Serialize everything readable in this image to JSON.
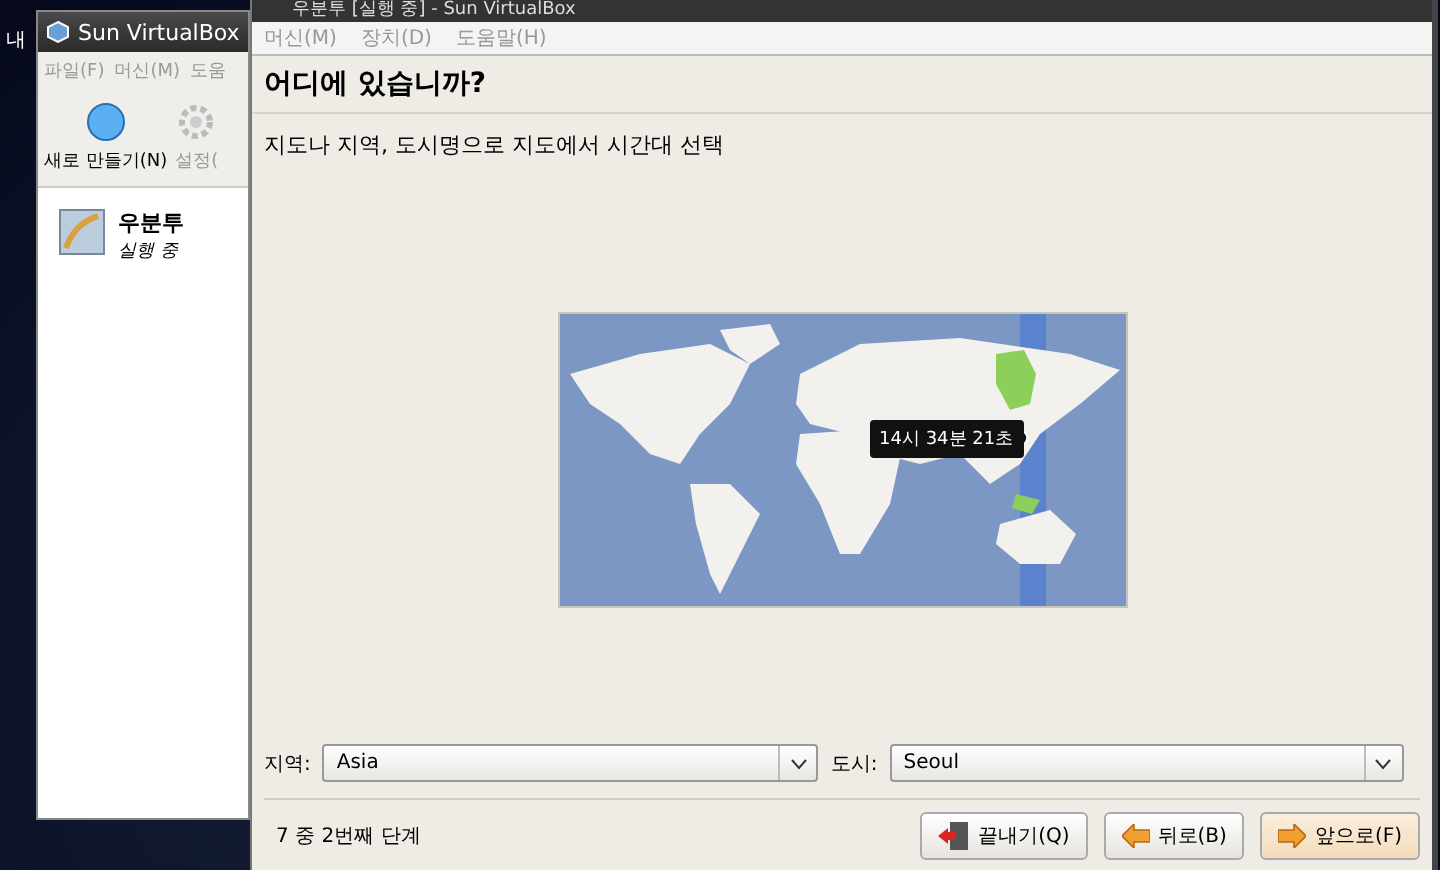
{
  "desktop": {
    "icon_labels": [
      "내"
    ]
  },
  "back_window": {
    "title": "Sun VirtualBox",
    "menu": [
      "파일(F)",
      "머신(M)",
      "도움"
    ],
    "toolbar": [
      {
        "label": "새로 만들기(N)",
        "kind": "new"
      },
      {
        "label": "설정(",
        "kind": "settings"
      }
    ],
    "vm_list": [
      {
        "name": "우분투",
        "status": "실행 중"
      }
    ]
  },
  "front_window": {
    "title": "우분투 [실행 중] - Sun VirtualBox",
    "menu": [
      "머신(M)",
      "장치(D)",
      "도움말(H)"
    ]
  },
  "wizard": {
    "heading": "어디에 있습니까?",
    "description": "지도나 지역, 도시명으로 지도에서 시간대 선택",
    "map": {
      "time_tooltip": "14시 34분 21초"
    },
    "region": {
      "label": "지역:",
      "value": "Asia"
    },
    "city": {
      "label": "도시:",
      "value": "Seoul"
    },
    "step": "7 중 2번째 단계",
    "buttons": [
      {
        "label": "끝내기(Q)",
        "kind": "quit"
      },
      {
        "label": "뒤로(B)",
        "kind": "back"
      },
      {
        "label": "앞으로(F)",
        "kind": "forward"
      }
    ]
  }
}
